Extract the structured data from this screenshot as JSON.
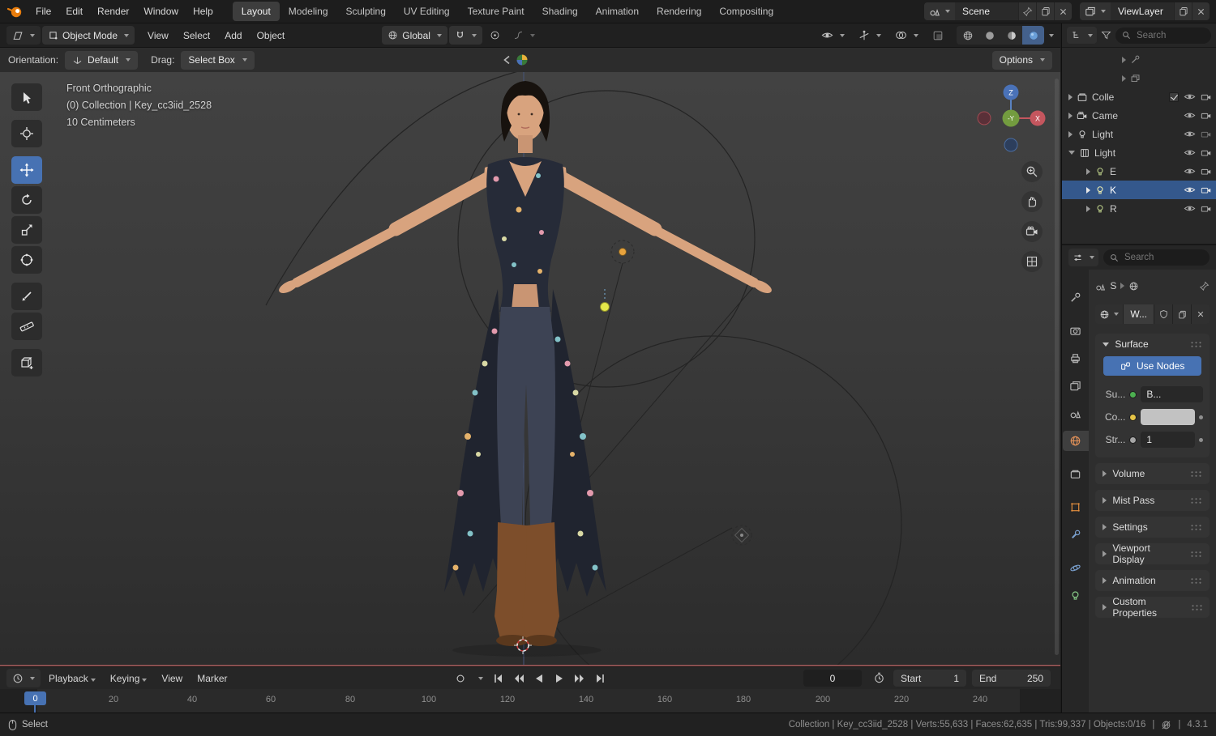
{
  "colors": {
    "accent": "#4772b3"
  },
  "topbar": {
    "menus": [
      "File",
      "Edit",
      "Render",
      "Window",
      "Help"
    ],
    "workspaces": [
      "Layout",
      "Modeling",
      "Sculpting",
      "UV Editing",
      "Texture Paint",
      "Shading",
      "Animation",
      "Rendering",
      "Compositing"
    ],
    "active_workspace": "Layout",
    "scene_label": "Scene",
    "viewlayer_label": "ViewLayer"
  },
  "viewport_header": {
    "mode": "Object Mode",
    "menus": [
      "View",
      "Select",
      "Add",
      "Object"
    ],
    "transform_orientation": "Global"
  },
  "tool_settings": {
    "orientation_label": "Orientation:",
    "orientation_value": "Default",
    "drag_label": "Drag:",
    "drag_value": "Select Box",
    "options_label": "Options"
  },
  "viewport": {
    "info_view": "Front Orthographic",
    "info_collection": "(0) Collection | Key_cc3iid_2528",
    "info_scale": "10 Centimeters",
    "axis_z": "Z",
    "axis_neg_y": "-Y",
    "axis_x": "X"
  },
  "outliner": {
    "search_placeholder": "Search",
    "rows": [
      {
        "label": "Colle"
      },
      {
        "label": "Came"
      },
      {
        "label": "Light"
      },
      {
        "label": "Light"
      },
      {
        "label": "E"
      },
      {
        "label": "K"
      },
      {
        "label": "R"
      }
    ]
  },
  "properties": {
    "search_placeholder": "Search",
    "breadcrumb_scene": "S",
    "world_name": "W...",
    "surface": {
      "title": "Surface",
      "use_nodes_label": "Use Nodes",
      "surface_label": "Su...",
      "surface_value": "B...",
      "color_label": "Co...",
      "strength_label": "Str...",
      "strength_value": "1"
    },
    "panels": [
      "Volume",
      "Mist Pass",
      "Settings",
      "Viewport Display",
      "Animation",
      "Custom Properties"
    ]
  },
  "timeline": {
    "menus": [
      "Playback",
      "Keying",
      "View",
      "Marker"
    ],
    "current_frame": "0",
    "start_label": "Start",
    "start_value": "1",
    "end_label": "End",
    "end_value": "250",
    "ticks": [
      "20",
      "40",
      "60",
      "80",
      "100",
      "120",
      "140",
      "160",
      "180",
      "200",
      "220",
      "240"
    ],
    "marker_frame": "0"
  },
  "statusbar": {
    "select_label": "Select",
    "stats": "Collection | Key_cc3iid_2528 | Verts:55,633 | Faces:62,635 | Tris:99,337 | Objects:0/16",
    "sep": "|",
    "version": "4.3.1"
  }
}
